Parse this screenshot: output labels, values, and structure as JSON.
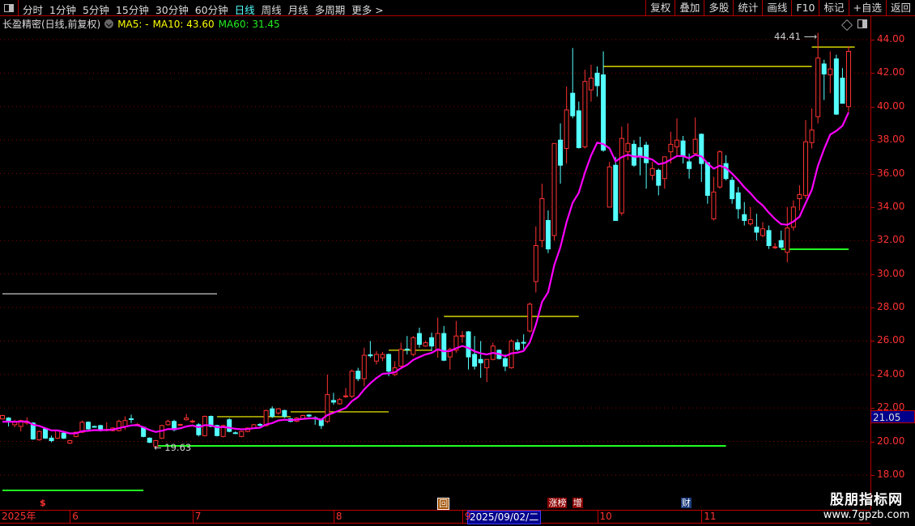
{
  "toolbar": {
    "periods": [
      "分时",
      "1分钟",
      "5分钟",
      "15分钟",
      "30分钟",
      "60分钟",
      "日线",
      "周线",
      "月线",
      "多周期",
      "更多 >"
    ],
    "active_period": "日线",
    "right_buttons": [
      "复权",
      "叠加",
      "多股",
      "统计",
      "画线",
      "F10",
      "标记",
      "+自选",
      "返回"
    ]
  },
  "legend": {
    "title": "长盈精密(日线,前复权)",
    "ma5": "MA5: -",
    "ma10": "MA10: 43.60",
    "ma60": "MA60: 31.45"
  },
  "axis": {
    "ticks": [
      "44.00",
      "42.00",
      "40.00",
      "38.00",
      "36.00",
      "34.00",
      "32.00",
      "30.00",
      "28.00",
      "26.00",
      "24.00",
      "22.00",
      "20.00",
      "18.00"
    ],
    "current_price": "21.05"
  },
  "annotations": {
    "high": "44.41",
    "low": "19.63"
  },
  "dates": {
    "labels": [
      {
        "t": "2025年",
        "i": 0
      },
      {
        "t": "6",
        "i": 11
      },
      {
        "t": "7",
        "i": 31
      },
      {
        "t": "8",
        "i": 54
      },
      {
        "t": "9",
        "i": 75
      },
      {
        "t": "10",
        "i": 97
      },
      {
        "t": "11",
        "i": 114
      }
    ],
    "highlight": "2025/09/02/二"
  },
  "markers": [
    {
      "t": "$",
      "i": 6.6,
      "k": "dollar"
    },
    {
      "t": "回",
      "i": 71.6,
      "k": "hui"
    },
    {
      "t": "涨榜",
      "i": 89.6,
      "k": "zb"
    },
    {
      "t": "增",
      "i": 93.6,
      "k": "zeng"
    },
    {
      "t": "财",
      "i": 111.3,
      "k": "cai"
    }
  ],
  "watermark": {
    "name": "股朋指标网",
    "url": "www.7gpzb.com"
  },
  "colors": {
    "up": "#ff3232",
    "down": "#54ffff",
    "line": "#ff00ff",
    "grid": "#8b0000",
    "level_yellow": "#ffff00",
    "level_green": "#22ff22",
    "level_white": "#dddddd"
  },
  "chart_data": {
    "type": "candlestick",
    "ylim": [
      17,
      45
    ],
    "yticks": [
      18,
      20,
      22,
      24,
      26,
      28,
      30,
      32,
      34,
      36,
      38,
      40,
      42,
      44
    ],
    "ohlc": [
      [
        21.35,
        21.6,
        21.3,
        21.55
      ],
      [
        21.4,
        21.45,
        20.9,
        21.2
      ],
      [
        21.0,
        21.3,
        20.85,
        21.15
      ],
      [
        20.9,
        21.3,
        20.6,
        21.25
      ],
      [
        21.1,
        21.45,
        21.0,
        21.2
      ],
      [
        21.1,
        21.15,
        20.1,
        20.15
      ],
      [
        20.1,
        20.65,
        20.05,
        20.6
      ],
      [
        20.75,
        20.8,
        20.15,
        20.2
      ],
      [
        20.2,
        20.35,
        19.95,
        20.05
      ],
      [
        20.2,
        20.7,
        20.15,
        20.65
      ],
      [
        20.5,
        20.55,
        20.15,
        20.2
      ],
      [
        19.9,
        20.1,
        19.85,
        20.05
      ],
      [
        20.3,
        20.6,
        20.25,
        20.55
      ],
      [
        20.55,
        21.25,
        20.5,
        21.15
      ],
      [
        21.15,
        21.2,
        20.7,
        20.75
      ],
      [
        20.9,
        20.95,
        20.85,
        20.88
      ],
      [
        20.95,
        21.0,
        20.6,
        20.65
      ],
      [
        20.68,
        21.15,
        20.6,
        20.72
      ],
      [
        20.65,
        20.85,
        20.6,
        20.8
      ],
      [
        20.65,
        21.3,
        20.6,
        21.2
      ],
      [
        20.9,
        21.5,
        20.7,
        21.25
      ],
      [
        21.36,
        21.6,
        21.1,
        21.34
      ],
      [
        20.98,
        21.1,
        20.95,
        21.02
      ],
      [
        20.85,
        20.9,
        20.25,
        20.3
      ],
      [
        20.2,
        20.25,
        19.9,
        19.95
      ],
      [
        19.7,
        20.1,
        19.63,
        20.05
      ],
      [
        20.2,
        21.0,
        20.15,
        20.95
      ],
      [
        21.0,
        21.3,
        20.95,
        21.2
      ],
      [
        21.2,
        21.3,
        20.6,
        20.7
      ],
      [
        20.98,
        21.05,
        20.95,
        21.02
      ],
      [
        21.3,
        21.65,
        21.25,
        21.4
      ],
      [
        21.18,
        21.3,
        21.1,
        21.22
      ],
      [
        21.0,
        21.1,
        20.3,
        20.4
      ],
      [
        20.35,
        21.55,
        20.3,
        21.5
      ],
      [
        21.5,
        21.55,
        20.85,
        20.9
      ],
      [
        20.95,
        21.0,
        20.3,
        20.35
      ],
      [
        20.3,
        21.0,
        20.25,
        20.95
      ],
      [
        21.3,
        21.4,
        20.55,
        20.6
      ],
      [
        20.52,
        20.6,
        20.45,
        20.48
      ],
      [
        20.3,
        20.65,
        20.25,
        20.6
      ],
      [
        20.6,
        20.85,
        20.55,
        20.8
      ],
      [
        20.8,
        21.05,
        20.75,
        21.0
      ],
      [
        21.02,
        21.1,
        20.9,
        20.98
      ],
      [
        20.95,
        21.9,
        20.9,
        21.85
      ],
      [
        21.95,
        22.1,
        21.4,
        21.5
      ],
      [
        21.7,
        22.0,
        21.6,
        21.95
      ],
      [
        21.85,
        21.9,
        21.4,
        21.5
      ],
      [
        21.35,
        21.4,
        21.15,
        21.2
      ],
      [
        21.2,
        21.45,
        21.15,
        21.4
      ],
      [
        21.35,
        21.6,
        21.3,
        21.55
      ],
      [
        21.58,
        21.62,
        21.45,
        21.52
      ],
      [
        21.42,
        21.5,
        21.0,
        21.38
      ],
      [
        21.3,
        21.35,
        20.75,
        20.95
      ],
      [
        21.2,
        24.0,
        21.1,
        22.8
      ],
      [
        22.45,
        22.9,
        22.2,
        22.35
      ],
      [
        22.25,
        22.6,
        22.2,
        22.5
      ],
      [
        22.68,
        23.2,
        22.6,
        22.72
      ],
      [
        22.7,
        24.3,
        22.6,
        24.2
      ],
      [
        24.2,
        24.4,
        23.6,
        23.75
      ],
      [
        23.75,
        25.6,
        23.3,
        25.15
      ],
      [
        25.18,
        26.0,
        25.0,
        25.12
      ],
      [
        24.8,
        25.4,
        24.6,
        25.2
      ],
      [
        25.0,
        25.35,
        24.8,
        25.2
      ],
      [
        25.2,
        25.25,
        23.9,
        24.2
      ],
      [
        24.0,
        24.8,
        23.9,
        24.4
      ],
      [
        24.5,
        25.9,
        24.45,
        25.5
      ],
      [
        25.52,
        26.3,
        25.2,
        25.48
      ],
      [
        25.2,
        26.3,
        25.1,
        26.2
      ],
      [
        26.45,
        26.8,
        25.6,
        25.8
      ],
      [
        25.7,
        26.0,
        25.65,
        25.9
      ],
      [
        26.2,
        26.5,
        25.4,
        25.7
      ],
      [
        25.45,
        27.4,
        25.0,
        26.45
      ],
      [
        26.45,
        26.9,
        24.8,
        24.85
      ],
      [
        25.05,
        25.6,
        24.3,
        25.5
      ],
      [
        25.45,
        27.2,
        25.3,
        26.3
      ],
      [
        26.28,
        26.6,
        25.9,
        26.32
      ],
      [
        26.55,
        26.6,
        24.3,
        25.05
      ],
      [
        25.2,
        26.3,
        24.3,
        24.5
      ],
      [
        24.9,
        26.0,
        23.8,
        24.7
      ],
      [
        24.4,
        24.9,
        23.55,
        24.9
      ],
      [
        24.9,
        25.9,
        24.85,
        25.7
      ],
      [
        25.45,
        25.5,
        24.9,
        24.95
      ],
      [
        24.95,
        25.2,
        24.2,
        24.5
      ],
      [
        24.4,
        26.1,
        24.35,
        26.0
      ],
      [
        25.9,
        26.1,
        25.4,
        25.5
      ],
      [
        25.92,
        26.4,
        25.5,
        25.88
      ],
      [
        26.6,
        28.3,
        26.5,
        28.2
      ],
      [
        29.55,
        32.85,
        28.9,
        31.7
      ],
      [
        32.0,
        35.4,
        31.6,
        34.5
      ],
      [
        33.2,
        33.8,
        31.25,
        31.5
      ],
      [
        32.3,
        37.8,
        32.0,
        37.8
      ],
      [
        38.0,
        39.0,
        35.4,
        36.5
      ],
      [
        37.5,
        41.2,
        36.6,
        39.8
      ],
      [
        40.8,
        43.5,
        39.3,
        39.45
      ],
      [
        39.75,
        40.3,
        37.5,
        37.55
      ],
      [
        37.6,
        42.2,
        37.5,
        41.5
      ],
      [
        41.0,
        42.5,
        40.3,
        41.7
      ],
      [
        42.0,
        42.4,
        40.6,
        41.25
      ],
      [
        41.9,
        43.3,
        37.3,
        37.4
      ],
      [
        34.0,
        36.7,
        34.0,
        36.4
      ],
      [
        36.5,
        37.0,
        33.2,
        33.2
      ],
      [
        33.65,
        38.8,
        33.5,
        38.1
      ],
      [
        37.3,
        39.0,
        36.8,
        37.8
      ],
      [
        37.75,
        38.0,
        36.4,
        36.5
      ],
      [
        37.55,
        38.2,
        35.9,
        37.05
      ],
      [
        37.7,
        37.9,
        35.1,
        36.65
      ],
      [
        35.9,
        36.7,
        35.6,
        36.3
      ],
      [
        36.2,
        36.3,
        34.7,
        35.3
      ],
      [
        35.7,
        37.0,
        35.1,
        37.0
      ],
      [
        37.3,
        38.5,
        36.6,
        37.75
      ],
      [
        37.6,
        39.3,
        37.0,
        38.0
      ],
      [
        37.95,
        38.25,
        36.6,
        37.05
      ],
      [
        36.7,
        37.2,
        35.7,
        36.3
      ],
      [
        37.2,
        39.35,
        37.1,
        38.05
      ],
      [
        38.35,
        38.4,
        35.5,
        36.6
      ],
      [
        36.65,
        36.7,
        34.2,
        34.7
      ],
      [
        33.3,
        35.8,
        33.2,
        34.9
      ],
      [
        35.2,
        37.4,
        35.1,
        37.3
      ],
      [
        36.6,
        37.1,
        35.6,
        35.7
      ],
      [
        35.6,
        35.8,
        34.2,
        34.5
      ],
      [
        34.85,
        35.2,
        33.3,
        33.9
      ],
      [
        33.55,
        34.3,
        32.9,
        33.2
      ],
      [
        33.0,
        34.0,
        32.9,
        33.25
      ],
      [
        32.8,
        33.6,
        32.0,
        32.5
      ],
      [
        32.3,
        33.1,
        32.2,
        32.7
      ],
      [
        32.6,
        32.9,
        31.5,
        31.7
      ],
      [
        31.58,
        31.85,
        31.5,
        31.62
      ],
      [
        32.0,
        32.6,
        31.5,
        31.6
      ],
      [
        31.3,
        34.0,
        30.7,
        32.75
      ],
      [
        32.8,
        34.4,
        32.6,
        34.0
      ],
      [
        34.5,
        35.3,
        33.8,
        34.75
      ],
      [
        34.7,
        39.2,
        34.5,
        37.9
      ],
      [
        37.85,
        39.9,
        37.5,
        38.6
      ],
      [
        39.4,
        44.41,
        39.0,
        42.9
      ],
      [
        42.55,
        42.8,
        40.4,
        41.95
      ],
      [
        41.9,
        43.3,
        40.8,
        42.25
      ],
      [
        42.85,
        43.1,
        39.5,
        39.55
      ],
      [
        41.7,
        42.3,
        40.2,
        40.2
      ],
      [
        40.0,
        43.6,
        39.7,
        43.3
      ]
    ],
    "line_period": 10,
    "levels": [
      {
        "price": 28.82,
        "from": 0,
        "to": 35,
        "color": "white"
      },
      {
        "price": 17.08,
        "from": 0,
        "to": 23,
        "color": "green"
      },
      {
        "price": 19.74,
        "from": 25,
        "to": 118,
        "color": "green"
      },
      {
        "price": 31.48,
        "from": 127,
        "to": 138,
        "color": "green"
      },
      {
        "price": 21.48,
        "from": 35,
        "to": 47,
        "color": "yellow"
      },
      {
        "price": 21.77,
        "from": 47,
        "to": 63,
        "color": "yellow"
      },
      {
        "price": 25.45,
        "from": 63,
        "to": 70,
        "color": "yellow"
      },
      {
        "price": 27.47,
        "from": 72,
        "to": 94,
        "color": "yellow"
      },
      {
        "price": 42.4,
        "from": 98,
        "to": 132,
        "color": "yellow"
      },
      {
        "price": 43.56,
        "from": 132,
        "to": 139,
        "color": "yellow"
      }
    ]
  }
}
